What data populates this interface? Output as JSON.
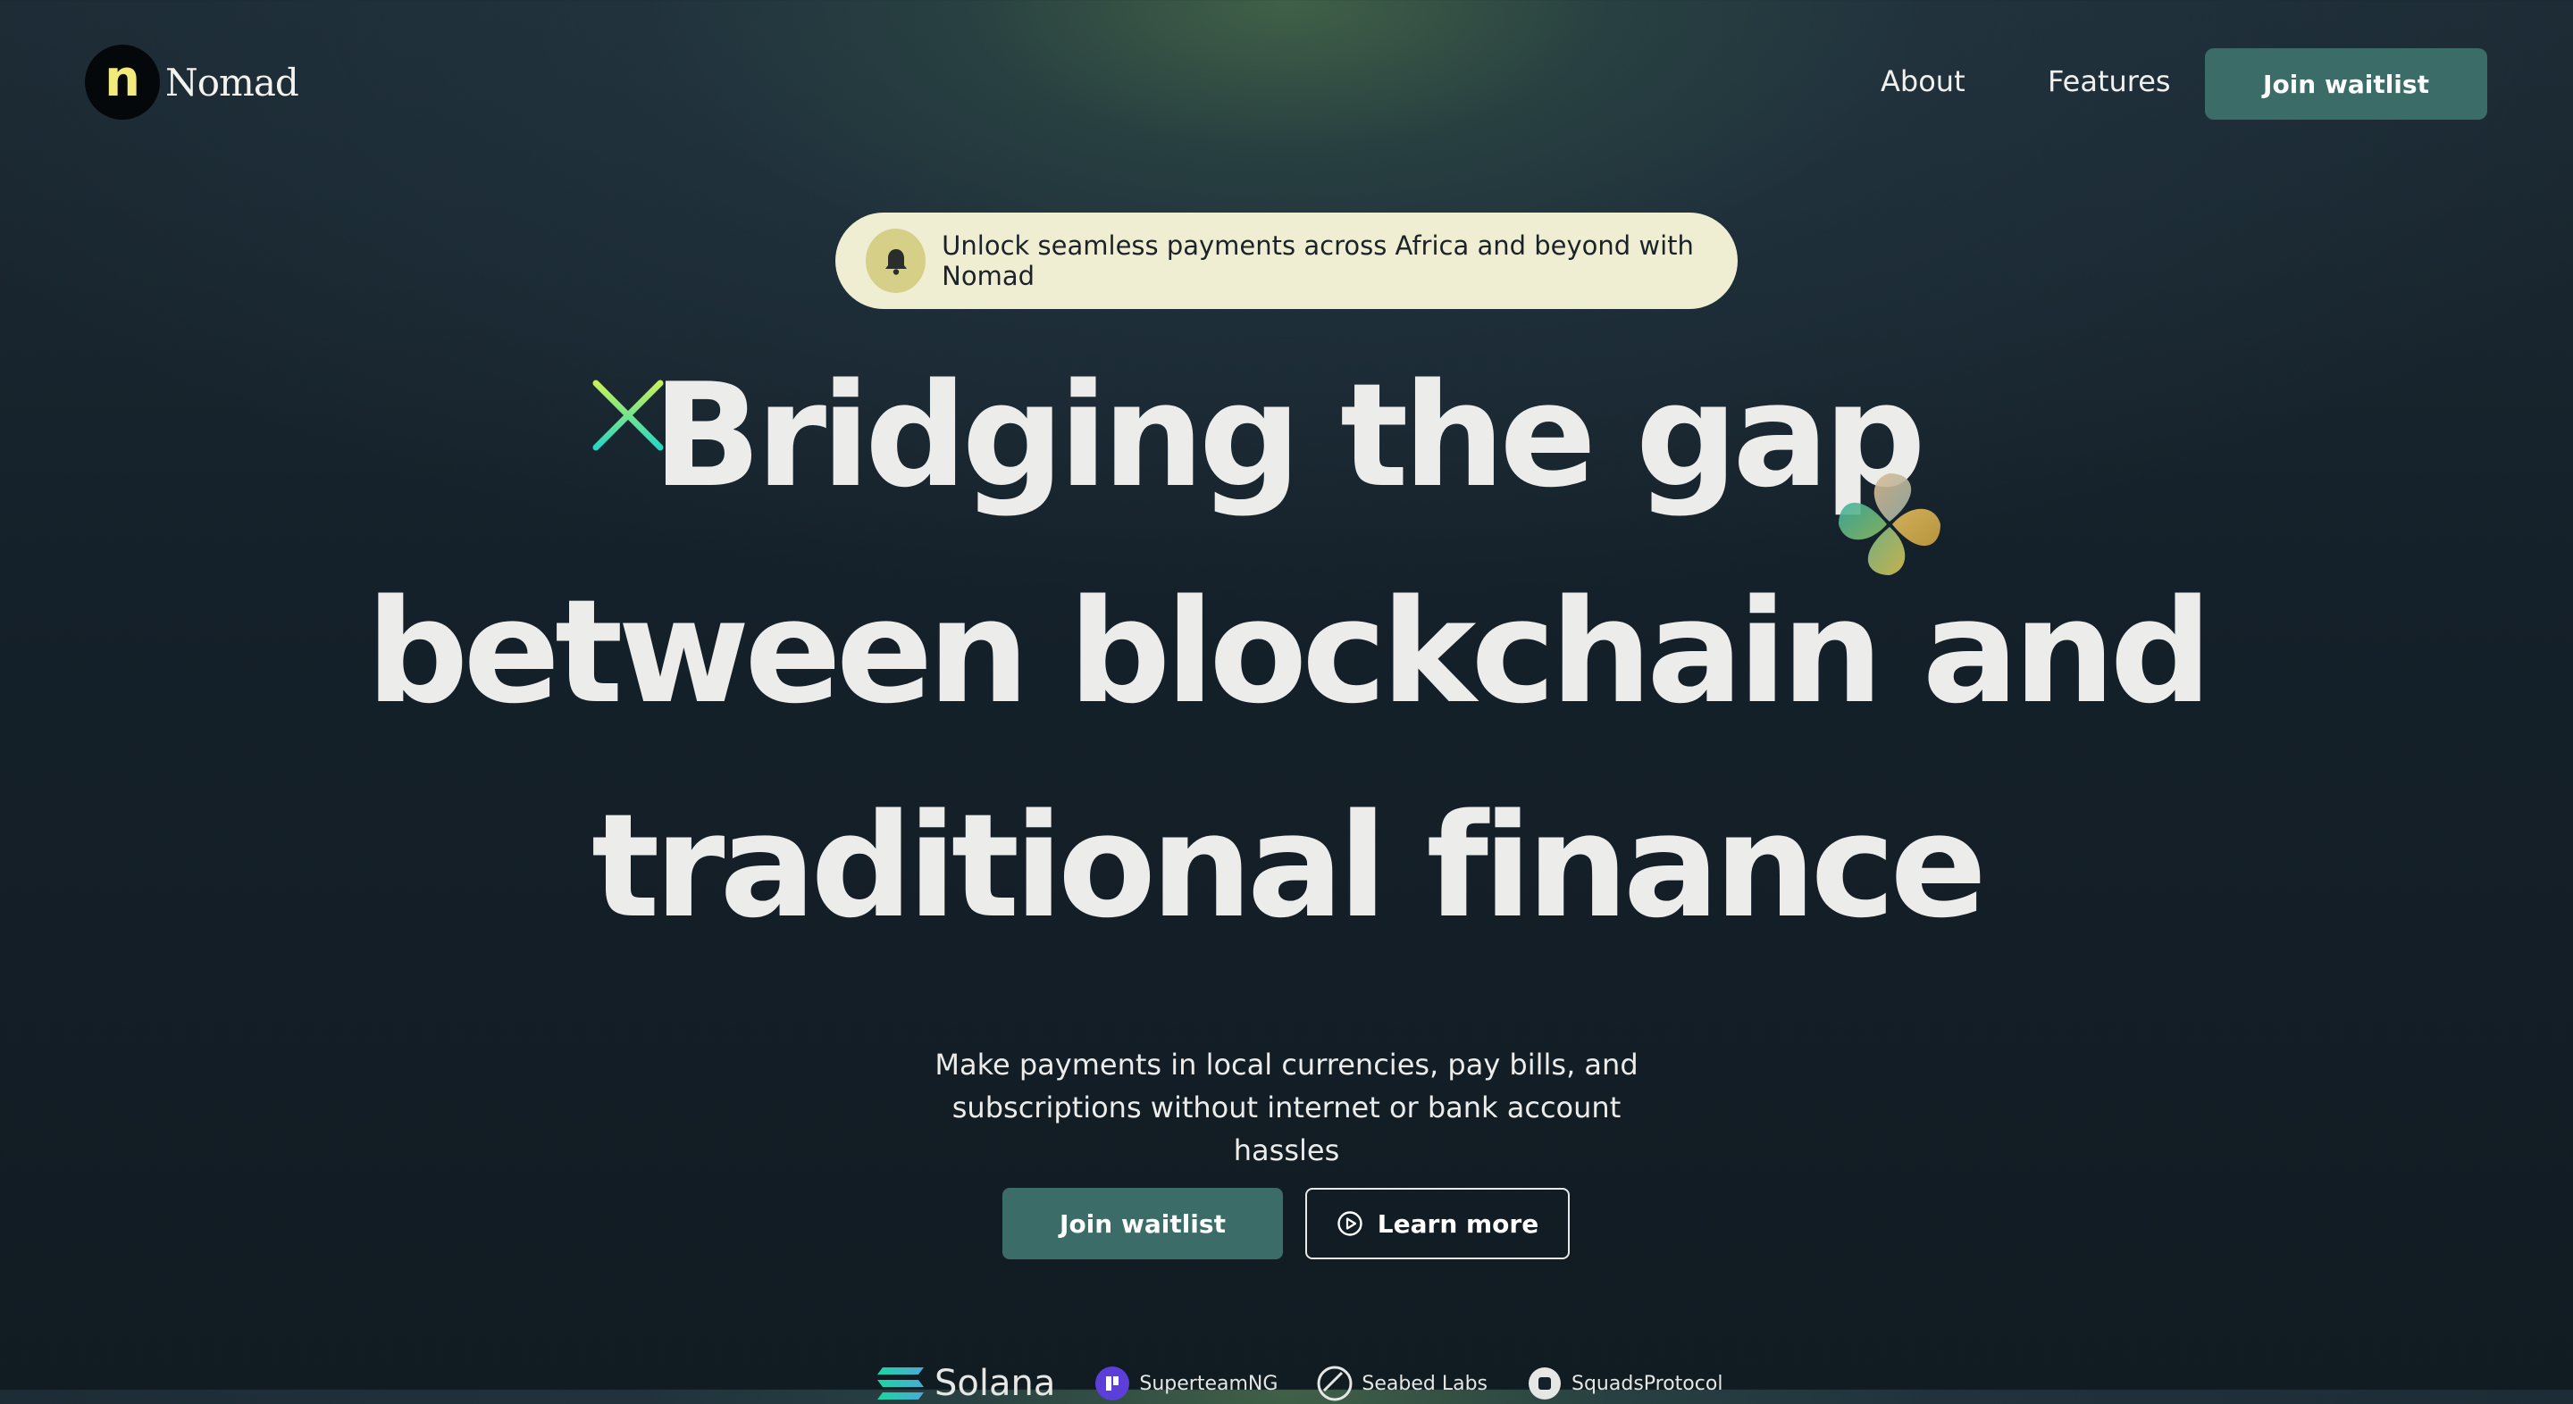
{
  "brand": {
    "logo_letter": "n",
    "name": "Nomad"
  },
  "nav": {
    "links": [
      "About",
      "Features"
    ],
    "cta_label": "Join waitlist"
  },
  "announcement": {
    "icon": "bell-icon",
    "text": "Unlock seamless payments across Africa and beyond with Nomad"
  },
  "hero": {
    "headline_lines": [
      "Bridging the gap",
      "between blockchain and",
      "traditional finance"
    ],
    "subtext": "Make payments in local currencies, pay bills, and subscriptions without internet or bank account hassles",
    "primary_button": "Join waitlist",
    "secondary_button": "Learn more",
    "secondary_icon": "play-circle-icon"
  },
  "partners": [
    {
      "name": "Solana",
      "icon": "solana-logo-icon"
    },
    {
      "name": "SuperteamNG",
      "icon": "superteam-logo-icon"
    },
    {
      "name": "Seabed Labs",
      "icon": "seabed-logo-icon"
    },
    {
      "name": "SquadsProtocol",
      "icon": "squads-logo-icon"
    }
  ],
  "colors": {
    "accent": "#3c6c68",
    "announcement_bg": "#efeed2",
    "bell_bg": "#d6cf88",
    "logo_letter": "#f2ea7a",
    "sparkle_top": "#c6f05a",
    "sparkle_bottom": "#27d6c2",
    "background": "#15212a"
  }
}
